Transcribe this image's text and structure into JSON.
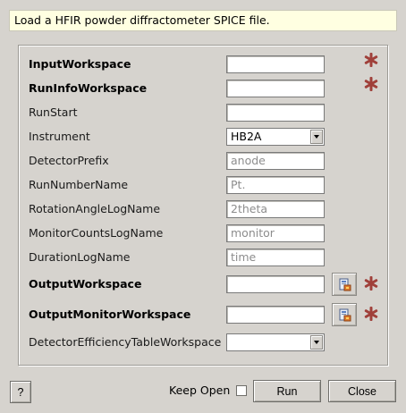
{
  "description": "Load a HFIR powder diffractometer SPICE file.",
  "properties": [
    {
      "name": "InputWorkspace",
      "bold": true,
      "type": "text",
      "value": "",
      "placeholder": "",
      "required": true,
      "browse": false
    },
    {
      "name": "RunInfoWorkspace",
      "bold": true,
      "type": "text",
      "value": "",
      "placeholder": "",
      "required": true,
      "browse": false
    },
    {
      "name": "RunStart",
      "bold": false,
      "type": "text",
      "value": "",
      "placeholder": "",
      "required": false,
      "browse": false
    },
    {
      "name": "Instrument",
      "bold": false,
      "type": "select",
      "value": "HB2A",
      "placeholder": "",
      "required": false,
      "browse": false
    },
    {
      "name": "DetectorPrefix",
      "bold": false,
      "type": "text",
      "value": "",
      "placeholder": "anode",
      "required": false,
      "browse": false
    },
    {
      "name": "RunNumberName",
      "bold": false,
      "type": "text",
      "value": "",
      "placeholder": "Pt.",
      "required": false,
      "browse": false
    },
    {
      "name": "RotationAngleLogName",
      "bold": false,
      "type": "text",
      "value": "",
      "placeholder": "2theta",
      "required": false,
      "browse": false
    },
    {
      "name": "MonitorCountsLogName",
      "bold": false,
      "type": "text",
      "value": "",
      "placeholder": "monitor",
      "required": false,
      "browse": false
    },
    {
      "name": "DurationLogName",
      "bold": false,
      "type": "text",
      "value": "",
      "placeholder": "time",
      "required": false,
      "browse": false
    },
    {
      "name": "OutputWorkspace",
      "bold": true,
      "type": "text",
      "value": "",
      "placeholder": "",
      "required": true,
      "browse": true
    },
    {
      "name": "OutputMonitorWorkspace",
      "bold": true,
      "type": "text",
      "value": "",
      "placeholder": "",
      "required": true,
      "browse": true
    },
    {
      "name": "DetectorEfficiencyTableWorkspace",
      "bold": false,
      "type": "select",
      "value": "",
      "placeholder": "",
      "required": false,
      "browse": false
    }
  ],
  "buttons": {
    "help": "?",
    "keep_open": "Keep Open",
    "keep_open_checked": false,
    "run": "Run",
    "close": "Close"
  },
  "colors": {
    "dialog_bg": "#d6d3ce",
    "description_bg": "#ffffe1",
    "required_star": "#a0403a"
  },
  "icons": {
    "required": "asterisk-icon",
    "browse": "workspace-browse-icon",
    "dropdown": "chevron-down-icon"
  }
}
